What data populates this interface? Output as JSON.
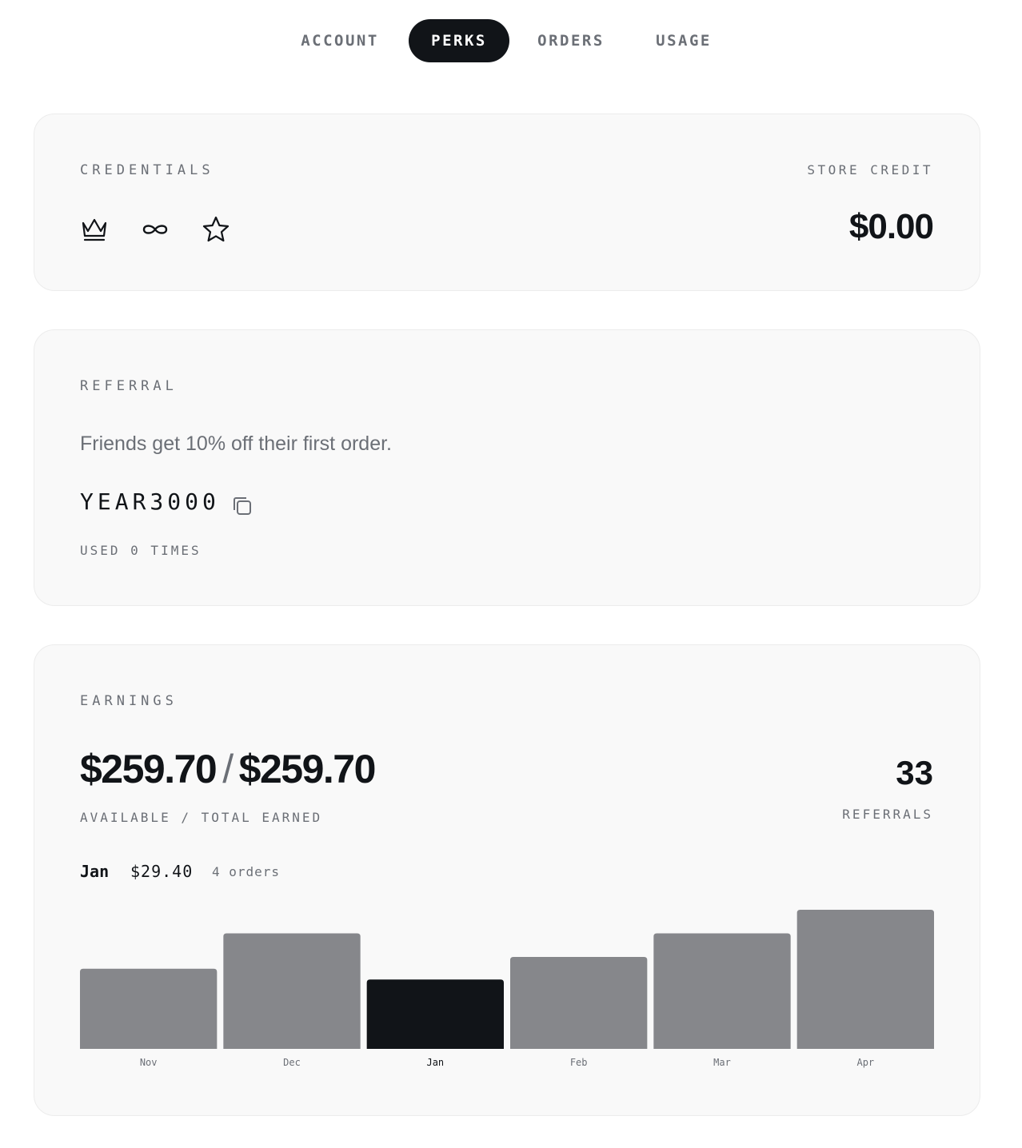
{
  "nav": {
    "tabs": [
      {
        "label": "ACCOUNT",
        "active": false
      },
      {
        "label": "PERKS",
        "active": true
      },
      {
        "label": "ORDERS",
        "active": false
      },
      {
        "label": "USAGE",
        "active": false
      }
    ]
  },
  "credentials": {
    "label": "CREDENTIALS",
    "icons": [
      "crown-icon",
      "infinity-icon",
      "star-icon"
    ],
    "store_credit_label": "STORE CREDIT",
    "store_credit_value": "$0.00"
  },
  "referral": {
    "label": "REFERRAL",
    "description": "Friends get 10% off their first order.",
    "code": "YEAR3000",
    "copy_icon": "copy-icon",
    "used_text": "USED 0 TIMES"
  },
  "earnings": {
    "label": "EARNINGS",
    "available": "$259.70",
    "separator": "/",
    "total": "$259.70",
    "caption": "AVAILABLE / TOTAL EARNED",
    "referrals_count": "33",
    "referrals_label": "REFERRALS",
    "selected": {
      "month": "Jan",
      "value": "$29.40",
      "orders": "4 orders"
    }
  },
  "colors": {
    "bar": "#86878b",
    "bar_selected": "#111418",
    "tick": "#6b6f76",
    "tick_selected": "#111418"
  },
  "chart_data": {
    "type": "bar",
    "categories": [
      "Nov",
      "Dec",
      "Jan",
      "Feb",
      "Mar",
      "Apr"
    ],
    "values": [
      34,
      49,
      29.4,
      39,
      49,
      59
    ],
    "selected": "Jan",
    "title": "",
    "xlabel": "",
    "ylabel": "",
    "ylim": [
      0,
      59
    ],
    "grid": false
  }
}
